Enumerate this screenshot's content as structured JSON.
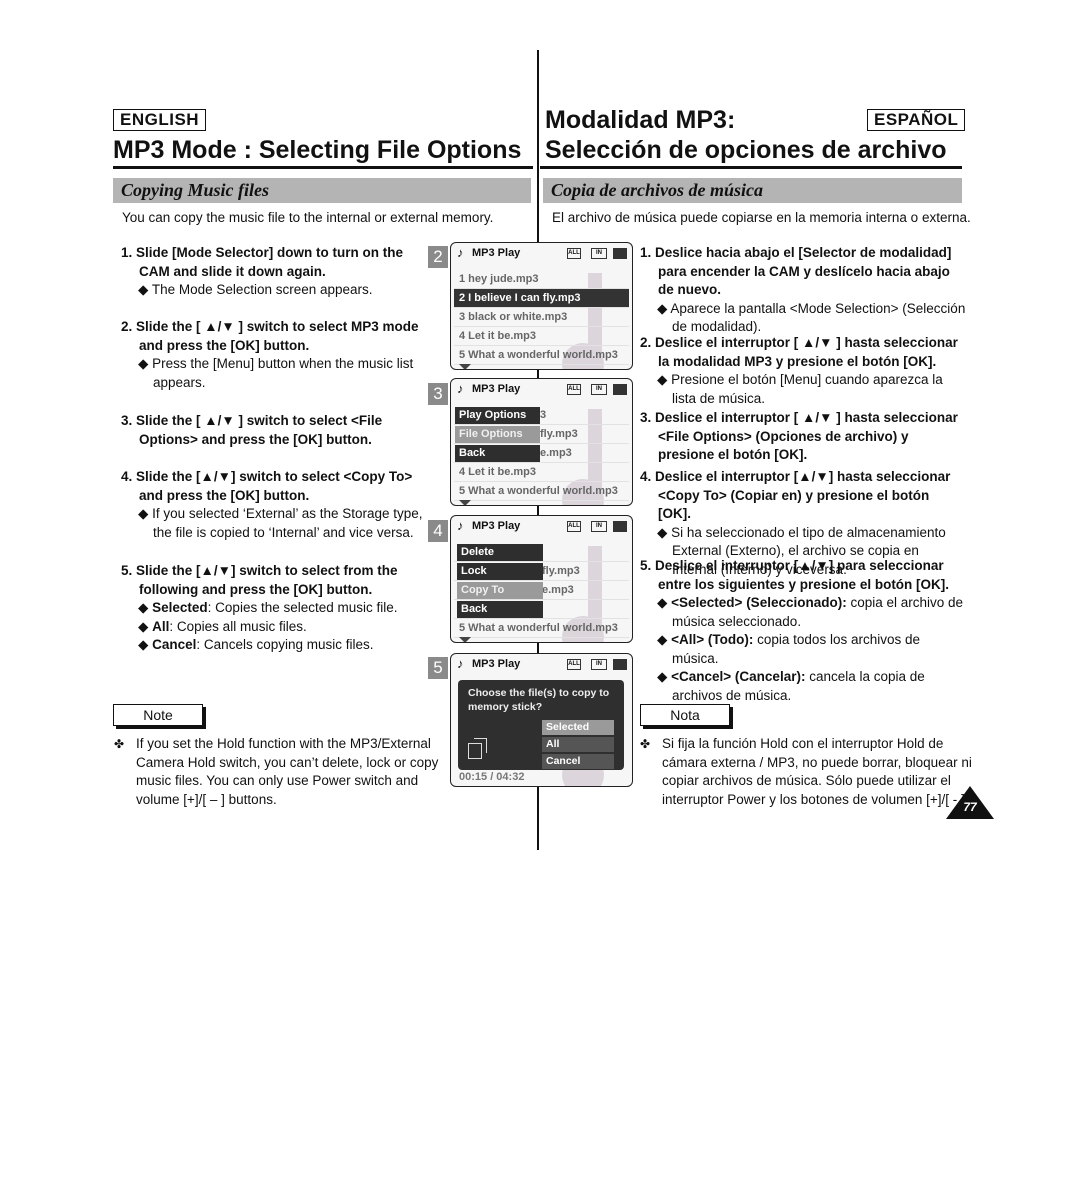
{
  "english": {
    "lang_label": "ENGLISH",
    "title": "MP3 Mode : Selecting File Options",
    "section": "Copying Music files",
    "intro": "You can copy the music file to the internal or external memory.",
    "steps": [
      {
        "head": "1. Slide [Mode Selector] down to turn on the CAM and slide it down again.",
        "bullets": [
          "◆ The Mode Selection screen appears."
        ]
      },
      {
        "head": "2. Slide the [ ▲/▼ ] switch to select MP3 mode and press the [OK] button.",
        "bullets": [
          "◆ Press the [Menu] button when the music list appears."
        ]
      },
      {
        "head": "3. Slide the [ ▲/▼ ] switch to select <File Options> and press the [OK] button.",
        "bullets": []
      },
      {
        "head": "4. Slide the [▲/▼] switch to select <Copy To> and press the [OK] button.",
        "bullets": [
          "◆ If you selected ‘External’ as the Storage type, the file is copied to ‘Internal’ and vice versa."
        ]
      },
      {
        "head": "5. Slide the [▲/▼] switch to select from the following and press the [OK] button.",
        "bullets": []
      }
    ],
    "step5_bullets": [
      {
        "term": "Selected",
        "desc": ": Copies the selected music file."
      },
      {
        "term": "All",
        "desc": ": Copies all music files."
      },
      {
        "term": "Cancel",
        "desc": ": Cancels copying music files."
      }
    ],
    "note_label": "Note",
    "note_text": "If you set the Hold function with the MP3/External Camera Hold switch, you can’t delete, lock or copy music files. You can only use Power switch and volume [+]/[ – ] buttons."
  },
  "spanish": {
    "lang_label": "ESPAÑOL",
    "title_line1": "Modalidad MP3:",
    "title_line2": "Selección de opciones de archivo",
    "section": "Copia de archivos de música",
    "intro": "El archivo de música puede copiarse en la memoria interna o externa.",
    "steps": [
      {
        "head": "1. Deslice hacia abajo el [Selector de modalidad] para encender la CAM y deslícelo hacia abajo de nuevo.",
        "bullets": [
          "◆ Aparece la pantalla <Mode Selection> (Selección de modalidad)."
        ]
      },
      {
        "head": "2. Deslice el interruptor [ ▲/▼ ] hasta seleccionar la modalidad MP3 y presione el botón [OK].",
        "bullets": [
          "◆ Presione el botón [Menu] cuando aparezca la lista de música."
        ]
      },
      {
        "head": "3. Deslice el interruptor [ ▲/▼ ] hasta seleccionar <File Options> (Opciones de archivo) y presione el botón [OK].",
        "bullets": []
      },
      {
        "head": "4. Deslice el interruptor [▲/▼] hasta seleccionar <Copy To> (Copiar en) y presione el botón [OK].",
        "bullets": [
          "◆ Si ha seleccionado el tipo de almacenamiento External (Externo), el archivo se copia en Internal (Interno) y viceversa."
        ]
      },
      {
        "head": "5. Deslice el interruptor [▲/▼] para seleccionar entre los siguientes y presione el botón [OK].",
        "bullets": []
      }
    ],
    "step5_bullets": [
      {
        "term": "<Selected> (Seleccionado):",
        "desc": " copia el archivo de música seleccionado."
      },
      {
        "term": "<All> (Todo):",
        "desc": " copia todos los archivos de música."
      },
      {
        "term": "<Cancel> (Cancelar):",
        "desc": " cancela la copia de archivos de música."
      }
    ],
    "note_label": "Nota",
    "note_text": "Si fija la función Hold con el interruptor Hold de cámara externa / MP3, no puede borrar, bloquear ni copiar archivos de música. Sólo puede utilizar el interruptor Power y los botones de volumen [+]/[ - ]."
  },
  "note_bullet": "✤",
  "page_number": "77",
  "screens": {
    "header_title": "MP3 Play",
    "icon_all": "ALL",
    "icon_in": "IN",
    "s2": {
      "num": "2",
      "rows": [
        "1  hey jude.mp3",
        "2  I believe I can fly.mp3",
        "3  black or white.mp3",
        "4  Let it be.mp3",
        "5  What a wonderful world.mp3"
      ],
      "selected_index": 1
    },
    "s3": {
      "num": "3",
      "menu": [
        "Play Options",
        "File Options",
        "Back"
      ],
      "rows_partial": [
        "3",
        "fly.mp3",
        "e.mp3"
      ],
      "rows": [
        "4  Let it be.mp3",
        "5  What a wonderful world.mp3"
      ],
      "highlight": "File Options"
    },
    "s4": {
      "num": "4",
      "menu": [
        "Delete",
        "Lock",
        "Copy To",
        "Back"
      ],
      "rows_partial": [
        "fly.mp3",
        "e.mp3"
      ],
      "rows": [
        "5  What a wonderful world.mp3"
      ],
      "highlight": "Copy To"
    },
    "s5": {
      "num": "5",
      "question": "Choose the file(s) to copy to memory stick?",
      "options": [
        "Selected",
        "All",
        "Cancel"
      ],
      "highlight": "Selected",
      "time": "00:15 / 04:32"
    }
  }
}
